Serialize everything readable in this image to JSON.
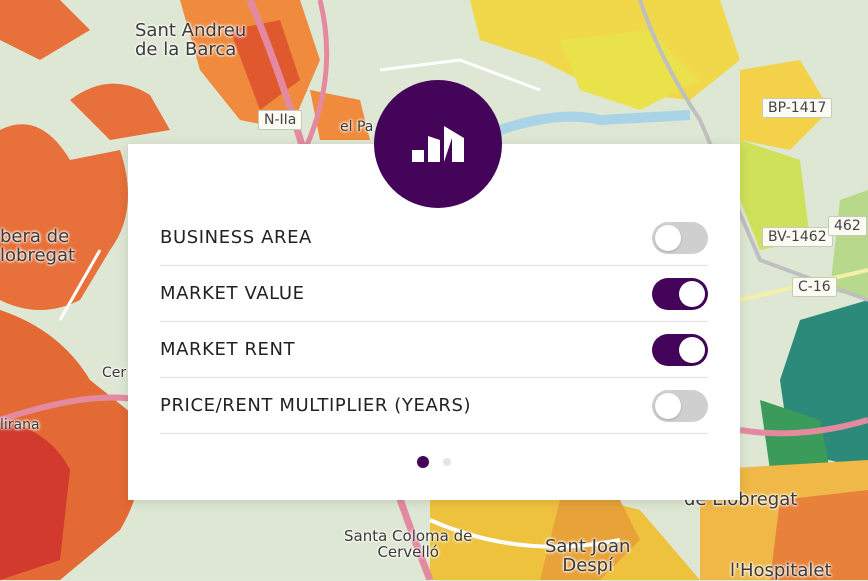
{
  "map": {
    "labels": [
      {
        "text": "Sant Andreu\nde la Barca"
      },
      {
        "text": "el Pa"
      },
      {
        "text": "bera de\nlobregat"
      },
      {
        "text": "Cer"
      },
      {
        "text": "lirana"
      },
      {
        "text": "Santa Coloma de\nCervelló"
      },
      {
        "text": "Sant Joan\nDespí"
      },
      {
        "text": "ugues\nde Llobregat"
      },
      {
        "text": "l'Hospitalet"
      }
    ],
    "road_shields": [
      "N-IIa",
      "BP-1417",
      "BV-1462",
      "462",
      "C-16"
    ]
  },
  "logo": {
    "icon": "brand-bars-icon",
    "color": "#44045a"
  },
  "toggles": [
    {
      "label": "BUSINESS AREA",
      "on": false
    },
    {
      "label": "MARKET VALUE",
      "on": true
    },
    {
      "label": "MARKET RENT",
      "on": true
    },
    {
      "label": "PRICE/RENT MULTIPLIER (YEARS)",
      "on": false
    }
  ],
  "pagination": {
    "pages": 2,
    "current": 1
  },
  "colors": {
    "accent": "#44045a",
    "toggle_off": "#cfcfcf"
  }
}
